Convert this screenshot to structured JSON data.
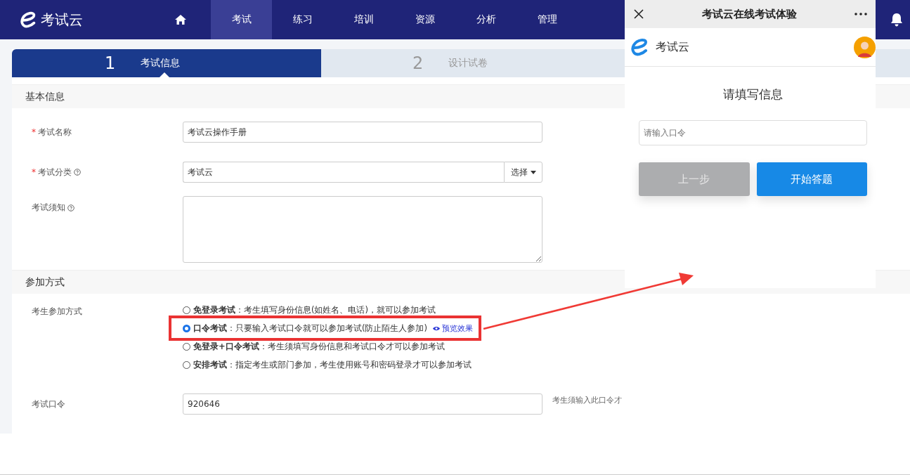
{
  "nav": {
    "brand": "考试云",
    "items": [
      {
        "kind": "home",
        "selected": false
      },
      {
        "kind": "text",
        "label": "考试",
        "selected": true
      },
      {
        "kind": "text",
        "label": "练习",
        "selected": false
      },
      {
        "kind": "text",
        "label": "培训",
        "selected": false
      },
      {
        "kind": "text",
        "label": "资源",
        "selected": false
      },
      {
        "kind": "text",
        "label": "分析",
        "selected": false
      },
      {
        "kind": "text",
        "label": "管理",
        "selected": false
      }
    ]
  },
  "steps": [
    {
      "number": "1",
      "label": "考试信息",
      "selected": true
    },
    {
      "number": "2",
      "label": "设计试卷",
      "selected": false
    }
  ],
  "basic_info": {
    "title": "基本信息",
    "fields": [
      {
        "kind": "text",
        "label": "考试名称",
        "required_mark": "*",
        "value": "考试云操作手册"
      },
      {
        "kind": "select",
        "label": "考试分类",
        "required_mark": "*",
        "help": true,
        "value": "考试云",
        "button": "选择"
      },
      {
        "kind": "textarea",
        "label": "考试须知",
        "help": true
      }
    ]
  },
  "join": {
    "title": "参加方式",
    "label": "考生参加方式",
    "options": [
      {
        "text": "**免登录考试**：考生填写身份信息(如姓名、电话)，就可以参加考试",
        "selected": false
      },
      {
        "text": "**口令考试**：只要输入考试口令就可以参加考试(防止陌生人参加)",
        "selected": true,
        "link": "预览效果",
        "highlighted": true
      },
      {
        "text": "**免登录+口令考试**：考生须填写身份信息和考试口令才可以参加考试",
        "selected": false
      },
      {
        "text": "**安排考试**：指定考生或部门参加，考生使用账号和密码登录才可以参加考试",
        "selected": false
      }
    ],
    "password": {
      "label": "考试口令",
      "value": "920646",
      "hint": "考生须输入此口令才"
    }
  },
  "preview": {
    "title": "考试云在线考试体验",
    "brand": "考试云",
    "heading": "请填写信息",
    "placeholder": "请输入口令",
    "buttons": [
      {
        "kind": "secondary",
        "label": "上一步"
      },
      {
        "kind": "primary",
        "label": "开始答题"
      }
    ]
  }
}
